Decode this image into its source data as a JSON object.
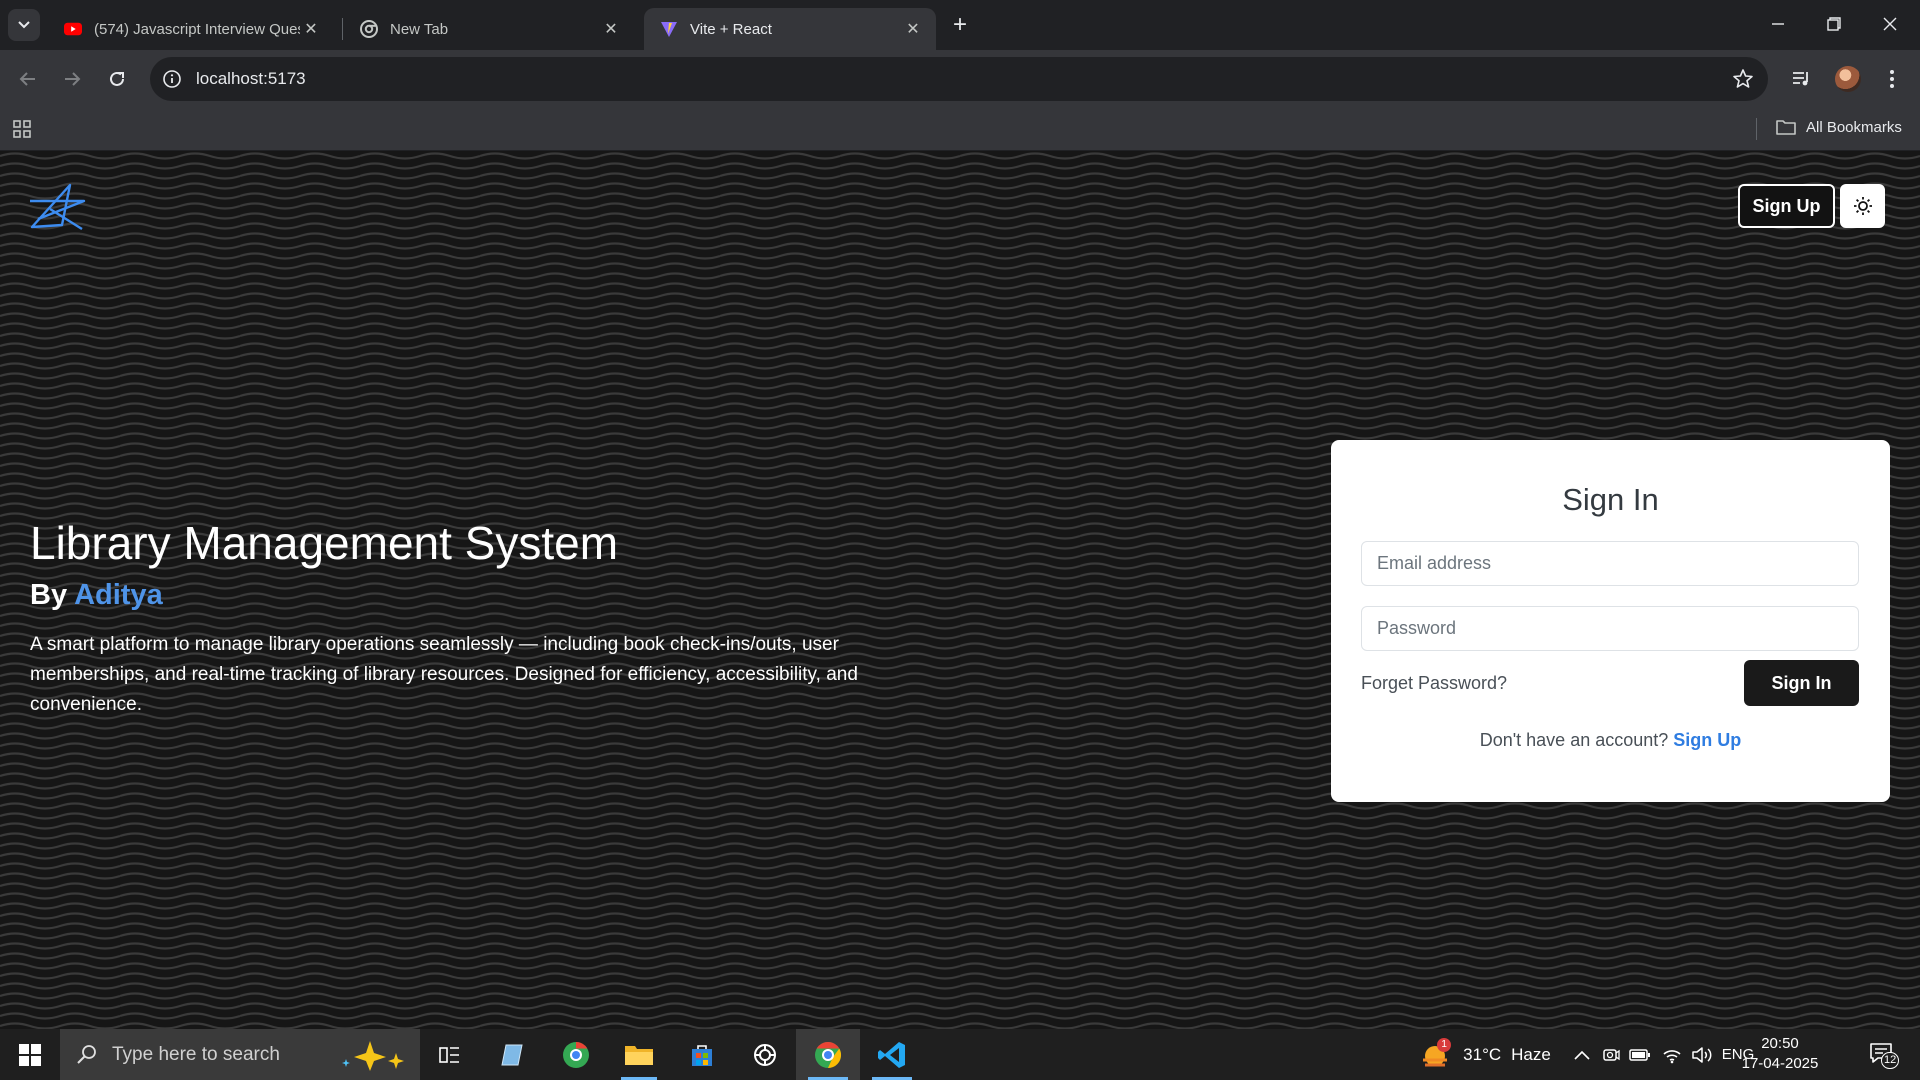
{
  "browser": {
    "tabs": [
      {
        "title": "(574) Javascript Interview Quest",
        "active": false
      },
      {
        "title": "New Tab",
        "active": false
      },
      {
        "title": "Vite + React",
        "active": true
      }
    ],
    "url": "localhost:5173",
    "bookmarks_label": "All Bookmarks"
  },
  "page": {
    "header": {
      "signup_label": "Sign Up"
    },
    "hero": {
      "title": "Library Management System",
      "by_prefix": "By",
      "author": "Aditya",
      "description": "A smart platform to manage library operations seamlessly — including book check-ins/outs, user memberships, and real-time tracking of library resources. Designed for efficiency, accessibility, and convenience."
    },
    "signin": {
      "title": "Sign In",
      "email_placeholder": "Email address",
      "password_placeholder": "Password",
      "forget_label": "Forget Password?",
      "button_label": "Sign In",
      "no_account_text": "Don't have an account?",
      "signup_link": "Sign Up"
    }
  },
  "taskbar": {
    "search_placeholder": "Type here to search",
    "weather": {
      "temp": "31°C",
      "condition": "Haze",
      "badge": "1"
    },
    "language": "ENG",
    "time": "20:50",
    "date": "17-04-2025",
    "notifications": "12"
  },
  "colors": {
    "accent": "#4f94e8",
    "link": "#2f7de1",
    "card_bg": "#ffffff",
    "page_bg": "#161616"
  }
}
